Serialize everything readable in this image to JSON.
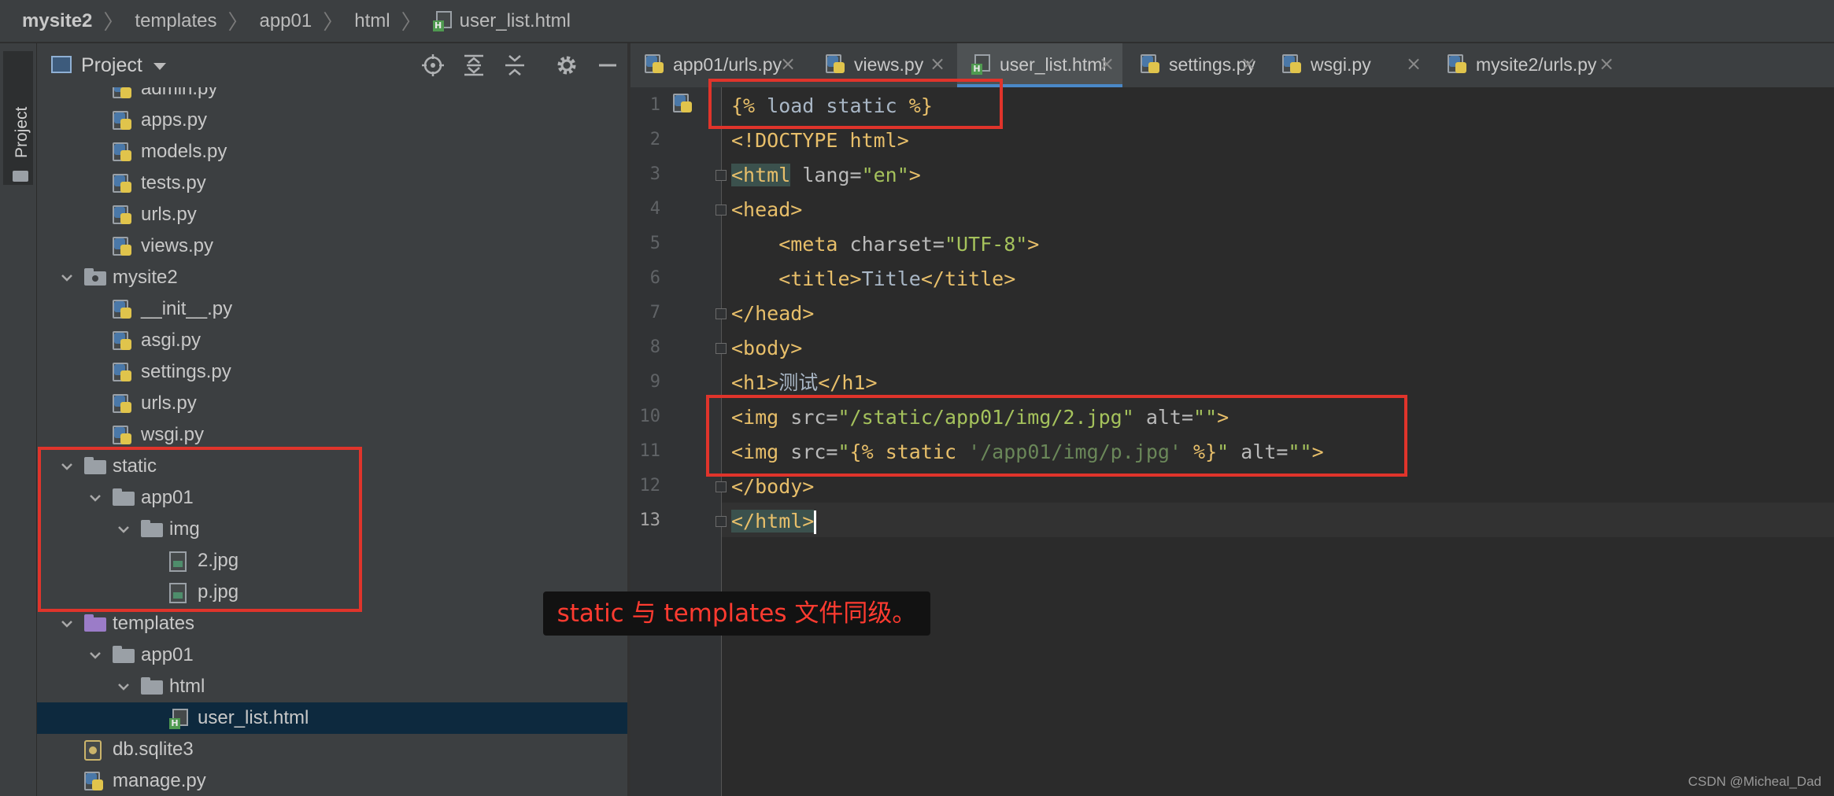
{
  "breadcrumb": [
    "mysite2",
    "templates",
    "app01",
    "html",
    "user_list.html"
  ],
  "sidebar_stripe": {
    "label": "Project"
  },
  "project_panel": {
    "title": "Project",
    "tree": [
      {
        "label": "admin.py",
        "type": "py",
        "depth": 3
      },
      {
        "label": "apps.py",
        "type": "py",
        "depth": 3
      },
      {
        "label": "models.py",
        "type": "py",
        "depth": 3
      },
      {
        "label": "tests.py",
        "type": "py",
        "depth": 3
      },
      {
        "label": "urls.py",
        "type": "py",
        "depth": 3
      },
      {
        "label": "views.py",
        "type": "py",
        "depth": 3
      },
      {
        "label": "mysite2",
        "type": "package",
        "depth": 2,
        "expanded": true
      },
      {
        "label": "__init__.py",
        "type": "py",
        "depth": 3
      },
      {
        "label": "asgi.py",
        "type": "py",
        "depth": 3
      },
      {
        "label": "settings.py",
        "type": "py",
        "depth": 3
      },
      {
        "label": "urls.py",
        "type": "py",
        "depth": 3
      },
      {
        "label": "wsgi.py",
        "type": "py",
        "depth": 3
      },
      {
        "label": "static",
        "type": "folder",
        "depth": 2,
        "expanded": true
      },
      {
        "label": "app01",
        "type": "folder",
        "depth": 3,
        "expanded": true
      },
      {
        "label": "img",
        "type": "folder",
        "depth": 4,
        "expanded": true
      },
      {
        "label": "2.jpg",
        "type": "image",
        "depth": 5
      },
      {
        "label": "p.jpg",
        "type": "image",
        "depth": 5
      },
      {
        "label": "templates",
        "type": "folder-purple",
        "depth": 2,
        "expanded": true
      },
      {
        "label": "app01",
        "type": "folder",
        "depth": 3,
        "expanded": true
      },
      {
        "label": "html",
        "type": "folder",
        "depth": 4,
        "expanded": true
      },
      {
        "label": "user_list.html",
        "type": "html",
        "depth": 5,
        "selected": true
      },
      {
        "label": "db.sqlite3",
        "type": "db",
        "depth": 2
      },
      {
        "label": "manage.py",
        "type": "py",
        "depth": 2
      }
    ]
  },
  "tabs": [
    {
      "label": "app01/urls.py",
      "type": "py"
    },
    {
      "label": "views.py",
      "type": "py"
    },
    {
      "label": "user_list.html",
      "type": "html",
      "active": true
    },
    {
      "label": "settings.py",
      "type": "py"
    },
    {
      "label": "wsgi.py",
      "type": "py"
    },
    {
      "label": "mysite2/urls.py",
      "type": "py"
    }
  ],
  "editor": {
    "current_line": 13,
    "lines": [
      [
        {
          "t": "{% ",
          "c": "t-tpl"
        },
        {
          "t": "load static",
          "c": "t-txt"
        },
        {
          "t": " %}",
          "c": "t-tpl"
        }
      ],
      [
        {
          "t": "<!DOCTYPE html>",
          "c": "t-tag"
        }
      ],
      [
        {
          "t": "<html",
          "c": "t-tag hl-html"
        },
        {
          "t": " lang=",
          "c": "t-attr"
        },
        {
          "t": "\"en\"",
          "c": "t-str"
        },
        {
          "t": ">",
          "c": "t-tag"
        }
      ],
      [
        {
          "t": "<head>",
          "c": "t-tag"
        }
      ],
      [
        {
          "t": "    <meta",
          "c": "t-tag"
        },
        {
          "t": " charset=",
          "c": "t-attr"
        },
        {
          "t": "\"UTF-8\"",
          "c": "t-str"
        },
        {
          "t": ">",
          "c": "t-tag"
        }
      ],
      [
        {
          "t": "    <title>",
          "c": "t-tag"
        },
        {
          "t": "Title",
          "c": "t-txt"
        },
        {
          "t": "</title>",
          "c": "t-tag"
        }
      ],
      [
        {
          "t": "</head>",
          "c": "t-tag"
        }
      ],
      [
        {
          "t": "<body>",
          "c": "t-tag"
        }
      ],
      [
        {
          "t": "<h1>",
          "c": "t-tag"
        },
        {
          "t": "测试",
          "c": "t-txt"
        },
        {
          "t": "</h1>",
          "c": "t-tag"
        }
      ],
      [
        {
          "t": "<img",
          "c": "t-tag"
        },
        {
          "t": " src=",
          "c": "t-attr"
        },
        {
          "t": "\"/static/app01/img/2.jpg\"",
          "c": "t-str"
        },
        {
          "t": " alt=",
          "c": "t-attr"
        },
        {
          "t": "\"\"",
          "c": "t-str"
        },
        {
          "t": ">",
          "c": "t-tag"
        }
      ],
      [
        {
          "t": "<img",
          "c": "t-tag"
        },
        {
          "t": " src=",
          "c": "t-attr"
        },
        {
          "t": "\"",
          "c": "t-str"
        },
        {
          "t": "{% ",
          "c": "t-tpl"
        },
        {
          "t": "static ",
          "c": "t-tpl"
        },
        {
          "t": "'/app01/img/p.jpg'",
          "c": "t-green"
        },
        {
          "t": " %}",
          "c": "t-tpl"
        },
        {
          "t": "\"",
          "c": "t-str"
        },
        {
          "t": " alt=",
          "c": "t-attr"
        },
        {
          "t": "\"\"",
          "c": "t-str"
        },
        {
          "t": ">",
          "c": "t-tag"
        }
      ],
      [
        {
          "t": "</body>",
          "c": "t-tag"
        }
      ],
      [
        {
          "t": "</html>",
          "c": "t-tag hl-html"
        }
      ]
    ]
  },
  "annotation": {
    "note": "static 与 templates 文件同级。"
  },
  "watermark": "CSDN @Micheal_Dad",
  "colors": {
    "annotation_red": "#e0342b",
    "selection_bg": "#0d293e",
    "active_tab_underline": "#4a88c7"
  }
}
